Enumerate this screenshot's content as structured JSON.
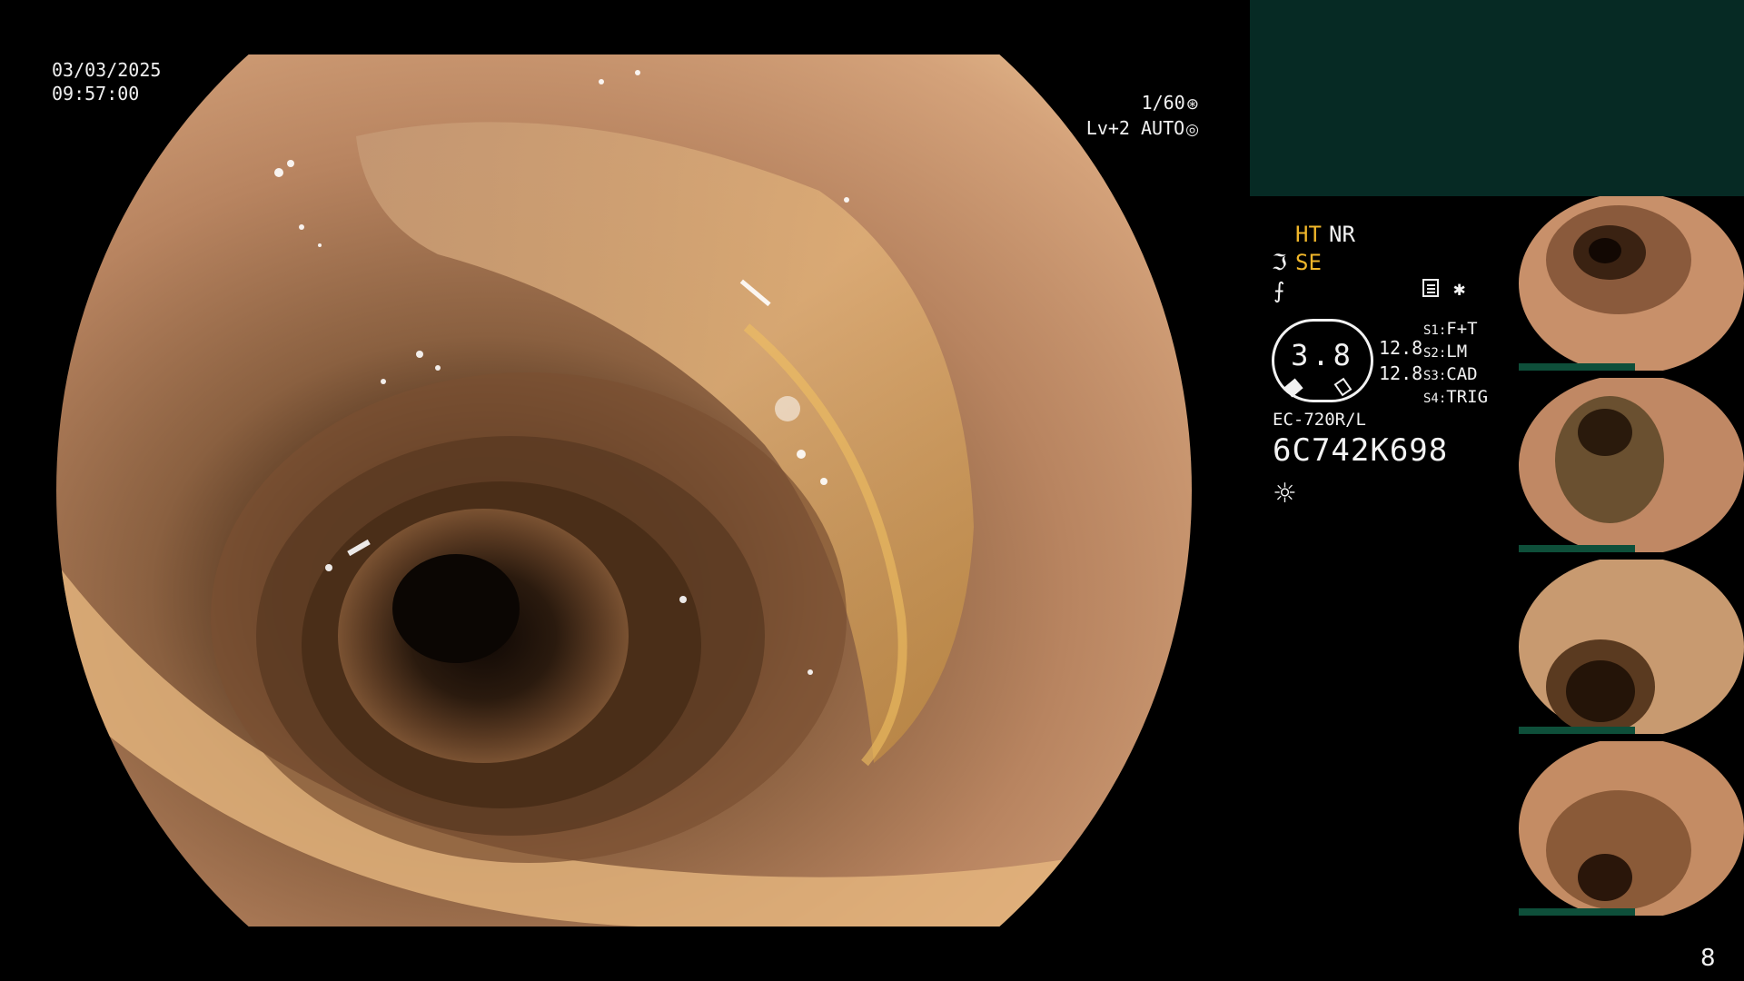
{
  "timestamp": {
    "date": "03/03/2025",
    "time": "09:57:00"
  },
  "shutter": {
    "speed": "1/60",
    "level": "Lv+2 AUTO"
  },
  "status": {
    "ht": "HT",
    "nr": "NR",
    "se": "SE",
    "gauge_value": "3.8",
    "gauge_a": "12.8",
    "gauge_b": "12.8",
    "scope_model": "EC-720R/L",
    "scope_serial": "6C742K698"
  },
  "slots": [
    {
      "key": "S1:",
      "value": "F+T"
    },
    {
      "key": "S2:",
      "value": "LM"
    },
    {
      "key": "S3:",
      "value": "CAD"
    },
    {
      "key": "S4:",
      "value": "TRIG"
    }
  ],
  "icons": {
    "shutter": "aperture-icon",
    "auto": "iris-icon",
    "wave": "structure-enhance-icon",
    "hook": "color-mode-icon",
    "note": "memo-icon",
    "star": "asterisk-icon",
    "light": "light-icon"
  },
  "colors": {
    "accent": "#f0b62a",
    "panel": "#062a24",
    "thumb_bar": "#0e4f3a"
  },
  "page": {
    "number": "8"
  }
}
